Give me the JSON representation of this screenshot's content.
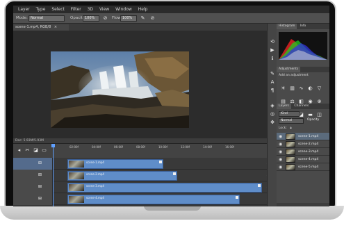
{
  "menu": [
    "Layer",
    "Type",
    "Select",
    "Filter",
    "3D",
    "View",
    "Window",
    "Help"
  ],
  "options_bar": {
    "mode_label": "Mode:",
    "mode_value": "Normal",
    "opacity_label": "Opacity:",
    "opacity_value": "100%",
    "flow_label": "Flow:",
    "flow_value": "100%"
  },
  "document_tab": "scene-1.mp4, RGB/8",
  "status_text": "Doc: 5.93M/5.93M",
  "panels": {
    "histogram_tab": "Histogram",
    "info_tab": "Info",
    "adjustments_tab": "Adjustments",
    "adjustments_hint": "Add an adjustment",
    "layers_tab": "Layers",
    "channels_tab": "Channels",
    "kind_value": "Kind",
    "blend_value": "Normal",
    "opacity_label": "Opacity",
    "lock_label": "Lock:",
    "layers": [
      "scene-1.mp4",
      "scene-2.mp4",
      "scene-3.mp4",
      "scene-4.mp4",
      "scene-5.mp4"
    ]
  },
  "timeline": {
    "ticks": [
      "02:00f",
      "04:00f",
      "06:00f",
      "08:00f",
      "10:00f",
      "12:00f",
      "14:00f",
      "16:00f"
    ],
    "clips": [
      {
        "name": "scene-1.mp4"
      },
      {
        "name": "scene-2.mp4"
      },
      {
        "name": "scene-3.mp4"
      },
      {
        "name": "scene-4.mp4"
      }
    ]
  },
  "colors": {
    "clip": "#5f8dc9",
    "ui_dark": "#3a3a3a",
    "playhead": "#5fa0ff"
  }
}
